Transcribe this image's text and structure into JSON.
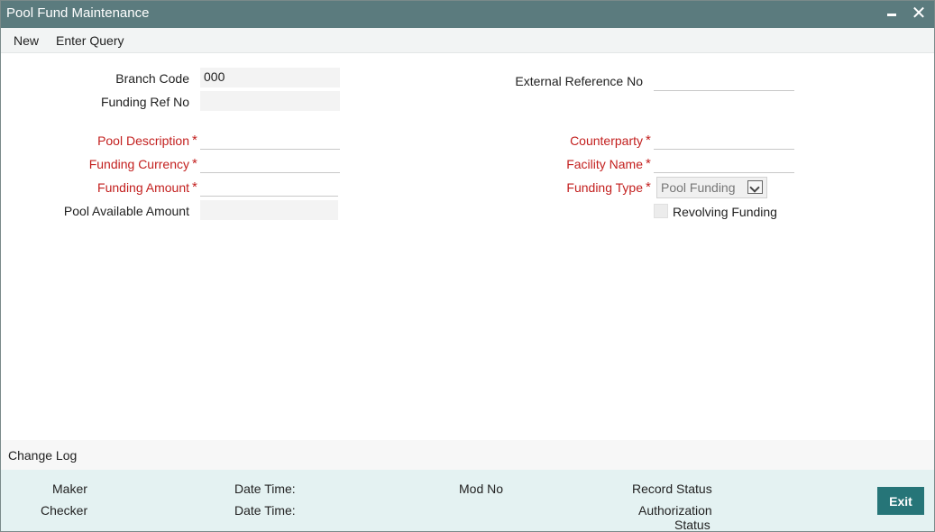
{
  "window": {
    "title": "Pool Fund Maintenance",
    "minimize_glyph": "",
    "close_glyph": "✕"
  },
  "menu": {
    "new_label": "New",
    "enter_query_label": "Enter Query"
  },
  "form": {
    "branch_code": {
      "label": "Branch Code",
      "value": "000"
    },
    "funding_ref_no": {
      "label": "Funding Ref No",
      "value": ""
    },
    "external_reference_no": {
      "label": "External Reference No",
      "value": ""
    },
    "pool_description": {
      "label": "Pool Description",
      "value": ""
    },
    "funding_currency": {
      "label": "Funding Currency",
      "value": ""
    },
    "funding_amount": {
      "label": "Funding Amount",
      "value": ""
    },
    "pool_available_amount": {
      "label": "Pool Available Amount",
      "value": ""
    },
    "counterparty": {
      "label": "Counterparty",
      "value": ""
    },
    "facility_name": {
      "label": "Facility Name",
      "value": ""
    },
    "funding_type": {
      "label": "Funding Type",
      "value": "Pool Funding"
    },
    "revolving_funding": {
      "label": "Revolving Funding",
      "checked": false
    },
    "required_marker": "*"
  },
  "change_log": {
    "label": "Change Log"
  },
  "audit": {
    "maker_label": "Maker",
    "checker_label": "Checker",
    "datetime_label_1": "Date Time:",
    "datetime_label_2": "Date Time:",
    "mod_no_label": "Mod No",
    "record_status_label": "Record Status",
    "authorization_label": "Authorization",
    "status_label": "Status"
  },
  "buttons": {
    "exit_label": "Exit"
  },
  "colors": {
    "titlebar": "#5b7b7e",
    "required": "#c3201f",
    "footer": "#e4f2f2",
    "exit_button": "#267578"
  }
}
